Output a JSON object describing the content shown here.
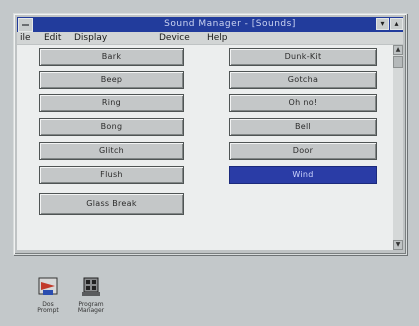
{
  "window": {
    "title": "Sound Manager - [Sounds]",
    "menu": [
      "ile",
      "Edit",
      "Display",
      "",
      "Device",
      "Help"
    ]
  },
  "left_buttons": [
    "Bark",
    "Beep",
    "Ring",
    "Bong",
    "Glitch",
    "Flush",
    "Glass Break"
  ],
  "right_buttons": [
    "Dunk-Kit",
    "Gotcha",
    "Oh no!",
    "Bell",
    "Door",
    "Wind"
  ],
  "selected_right_index": 5,
  "desktop_icons": [
    "Dos Prompt",
    "Program Manager"
  ],
  "colors": {
    "title_bar": "#223c9c",
    "selected": "#2a3ca6"
  }
}
